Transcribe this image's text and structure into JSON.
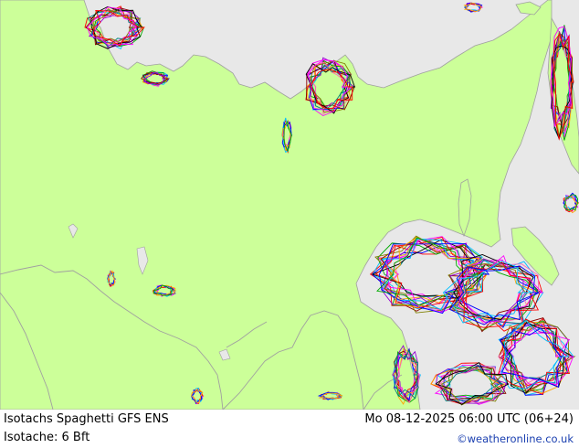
{
  "map": {
    "land_color": "#ccff99",
    "sea_color": "#e8e8e8",
    "border_color": "#a0a0a0",
    "spaghetti_colors": [
      "#ff00ff",
      "#ff0000",
      "#00bfff",
      "#0000ff",
      "#ffa500",
      "#00aa00",
      "#8b0000",
      "#9400d3",
      "#ff69b4",
      "#008080",
      "#808000",
      "#000000"
    ]
  },
  "footer": {
    "title": "Isotachs Spaghetti  GFS ENS",
    "datetime": "Mo 08-12-2025 06:00 UTC (06+24)",
    "level": "Isotache: 6 Bft",
    "site": "©weatheronline.co.uk"
  }
}
